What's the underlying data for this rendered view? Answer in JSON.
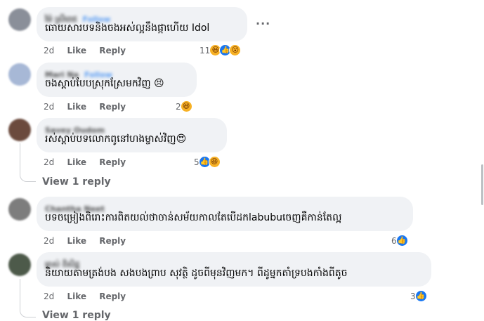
{
  "comments": [
    {
      "name": "ម៉ៃ ស្រីពេជ",
      "follow": "Follow",
      "text": "ធោយសារបទនិងចងអស់ល្អនឹងផ្កាហើយ Idol",
      "time": "2d",
      "like": "Like",
      "reply": "Reply",
      "reaction_count": "11",
      "reactions": [
        "haha",
        "like",
        "wow"
      ],
      "avatar_color": "#8a8f99"
    },
    {
      "name": "Mari Na",
      "follow": "Follow",
      "text": "ចងស្តាប់បែបស្រុកស្រែមកវិញ 😣",
      "time": "2d",
      "like": "Like",
      "reply": "Reply",
      "reaction_count": "2",
      "reactions": [
        "haha"
      ],
      "avatar_color": "#a7b8d6"
    },
    {
      "name": "Savey Oudom",
      "follow": "",
      "text": "រស់ស្តាប់បទលោកពូនៅហងម្ចាស់វិញ😍",
      "time": "2d",
      "like": "Like",
      "reply": "Reply",
      "reaction_count": "5",
      "reactions": [
        "like",
        "haha"
      ],
      "avatar_color": "#6b4a3d",
      "view_reply": "View 1 reply"
    },
    {
      "name": "Chantha Neet",
      "follow": "",
      "text": "បទចម្រៀងពិរោះការពិតយល់ថាចាន់សម័យកាលតែបើដកlabubuចេញគឺកាន់តែល្អ",
      "time": "2d",
      "like": "Like",
      "reply": "Reply",
      "reaction_count": "6",
      "reactions": [
        "like"
      ],
      "avatar_color": "#7d7d7d"
    },
    {
      "name": "ម្ចាស់ ពិសិដ្ឋ",
      "follow": "",
      "text": "និយាយតាមត្រង់បង សងបងព្រាប សុវត្ថិ ដូចពីមុនវិញមក។ ពីដូម្នកតាំទ្របងកាំងពីតូច",
      "time": "2d",
      "like": "Like",
      "reply": "Reply",
      "reaction_count": "3",
      "reactions": [
        "like"
      ],
      "avatar_color": "#4d5a4a",
      "view_reply": "View 1 reply"
    }
  ],
  "more_options": "···"
}
